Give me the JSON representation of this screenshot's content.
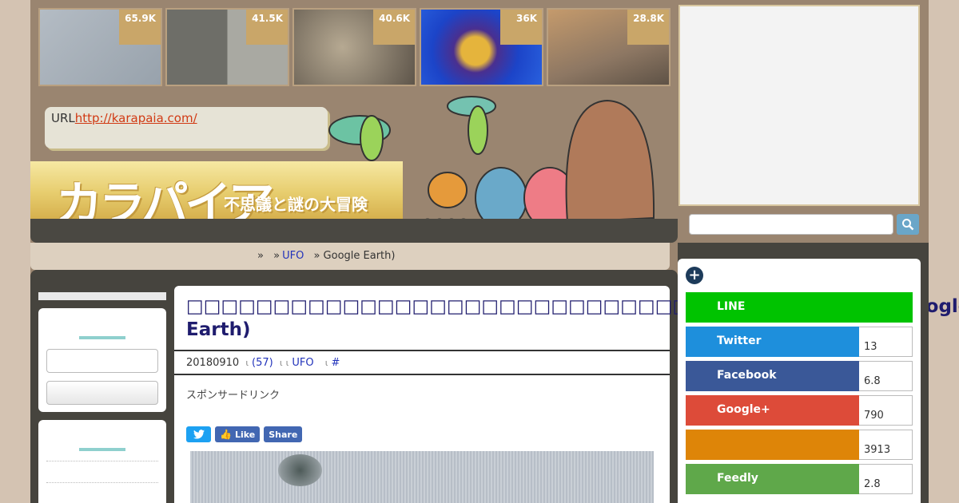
{
  "thumbnails": [
    {
      "count": "65.9K",
      "bg": "#a8b0b8"
    },
    {
      "count": "41.5K",
      "bg": "#8a8a84"
    },
    {
      "count": "40.6K",
      "bg": "#7e7466"
    },
    {
      "count": "36K",
      "bg": "#1f3fb5"
    },
    {
      "count": "28.8K",
      "bg": "#b69470"
    }
  ],
  "header": {
    "url_label": "URL",
    "url_link": "http://karapaia.com/",
    "logo_text": "カラパイア",
    "logo_subtitle": "不思議と謎の大冒険"
  },
  "breadcrumb": {
    "sep1": "»",
    "sep2": "»",
    "category": "UFO",
    "current": "» Google Earth)"
  },
  "article": {
    "title": "□□□□□□□□□□□□□□□□□□□□□□□□□□□□□□□□□□□□□□□□□Google Earth)",
    "date": "20180910",
    "comments": "(57)",
    "category": "UFO",
    "tag": "#",
    "sponsor": "スポンサードリンク",
    "share": {
      "twitter_icon": "twitter-bird",
      "like": "Like",
      "share": "Share"
    }
  },
  "sns": [
    {
      "name": "LINE",
      "count": "",
      "color": "#00c300"
    },
    {
      "name": "Twitter",
      "count": "13",
      "color": "#1e8fdc"
    },
    {
      "name": "Facebook",
      "count": "6.8",
      "color": "#3a5898"
    },
    {
      "name": "Google+",
      "count": "790",
      "color": "#dd4b39"
    },
    {
      "name": "",
      "count": "3913",
      "color": "#de8508"
    },
    {
      "name": "Feedly",
      "count": "2.8",
      "color": "#5fa84a"
    }
  ],
  "colors": {
    "page_bg": "#9a8570",
    "dark_bg": "#46443e",
    "accent_link": "#2233bb",
    "title_color": "#1f1c6e"
  }
}
